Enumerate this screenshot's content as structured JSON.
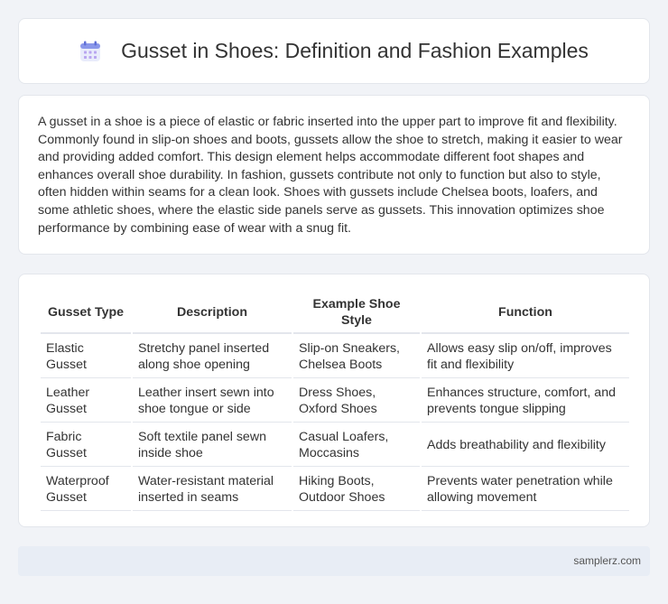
{
  "header": {
    "title": "Gusset in Shoes: Definition and Fashion Examples",
    "icon": "calendar-icon"
  },
  "intro": {
    "text": "A gusset in a shoe is a piece of elastic or fabric inserted into the upper part to improve fit and flexibility. Commonly found in slip-on shoes and boots, gussets allow the shoe to stretch, making it easier to wear and providing added comfort. This design element helps accommodate different foot shapes and enhances overall shoe durability. In fashion, gussets contribute not only to function but also to style, often hidden within seams for a clean look. Shoes with gussets include Chelsea boots, loafers, and some athletic shoes, where the elastic side panels serve as gussets. This innovation optimizes shoe performance by combining ease of wear with a snug fit."
  },
  "table": {
    "headers": [
      "Gusset Type",
      "Description",
      "Example Shoe Style",
      "Function"
    ],
    "rows": [
      [
        "Elastic Gusset",
        "Stretchy panel inserted along shoe opening",
        "Slip-on Sneakers, Chelsea Boots",
        "Allows easy slip on/off, improves fit and flexibility"
      ],
      [
        "Leather Gusset",
        "Leather insert sewn into shoe tongue or side",
        "Dress Shoes, Oxford Shoes",
        "Enhances structure, comfort, and prevents tongue slipping"
      ],
      [
        "Fabric Gusset",
        "Soft textile panel sewn inside shoe",
        "Casual Loafers, Moccasins",
        "Adds breathability and flexibility"
      ],
      [
        "Waterproof Gusset",
        "Water-resistant material inserted in seams",
        "Hiking Boots, Outdoor Shoes",
        "Prevents water penetration while allowing movement"
      ]
    ]
  },
  "footer": {
    "site": "samplerz.com"
  },
  "colors": {
    "page_background": "#f1f3f7",
    "card_background": "#ffffff",
    "icon_accent": "#6f7fe0",
    "footer_background": "#e8edf5"
  }
}
